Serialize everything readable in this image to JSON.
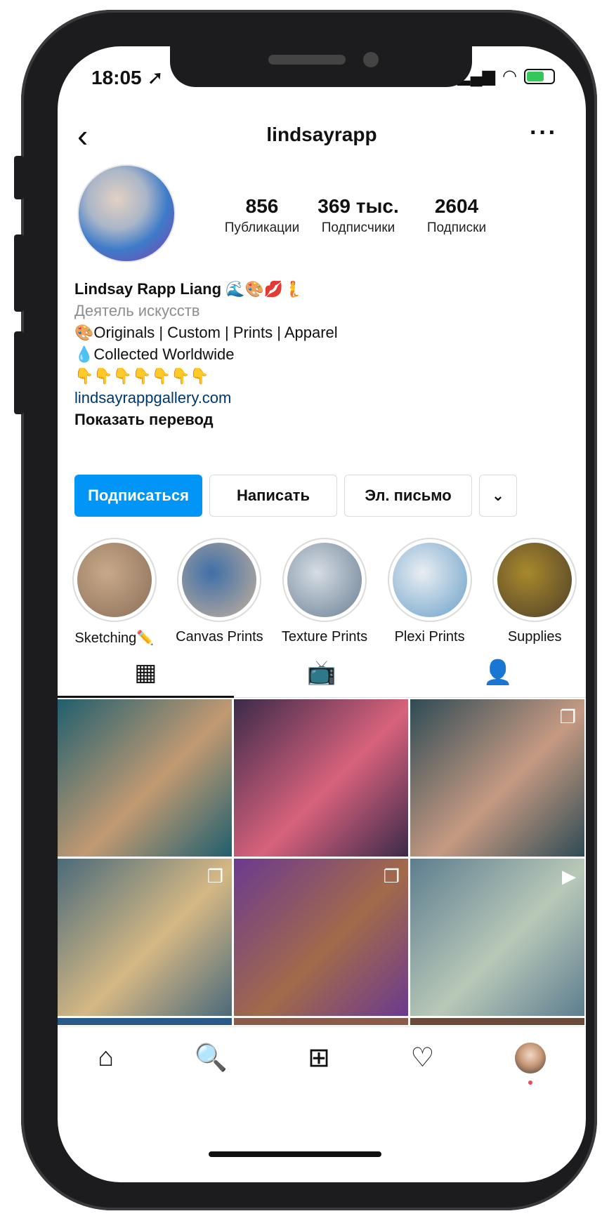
{
  "status": {
    "time": "18:05",
    "location_icon": "location-arrow-icon",
    "signal_icon": "signal-icon",
    "wifi_icon": "wifi-icon",
    "battery_icon": "battery-charging-icon"
  },
  "header": {
    "back_icon": "chevron-left-icon",
    "username": "lindsayrapp",
    "more_icon": "ellipsis-icon"
  },
  "profile": {
    "stats": [
      {
        "value": "856",
        "label": "Публикации"
      },
      {
        "value": "369 тыс.",
        "label": "Подписчики"
      },
      {
        "value": "2604",
        "label": "Подписки"
      }
    ],
    "name": "Lindsay Rapp Liang 🌊🎨💋🧜",
    "category": "Деятель искусств",
    "bio_line1": "🎨Originals | Custom | Prints | Apparel",
    "bio_line2": "💧Collected Worldwide",
    "bio_line3": "👇👇👇👇👇👇👇",
    "link": "lindsayrappgallery.com",
    "translate": "Показать перевод"
  },
  "buttons": {
    "follow": "Подписаться",
    "message": "Написать",
    "email": "Эл. письмо",
    "dropdown_icon": "chevron-down-icon"
  },
  "highlights": [
    {
      "label": "Sketching✏️",
      "color1": "#c9a98a",
      "color2": "#8a6f58"
    },
    {
      "label": "Canvas Prints",
      "color1": "#3f6fa8",
      "color2": "#c7b19c"
    },
    {
      "label": "Texture Prints",
      "color1": "#d6dde3",
      "color2": "#6a7f95"
    },
    {
      "label": "Plexi Prints",
      "color1": "#e9eef2",
      "color2": "#6aa0c9"
    },
    {
      "label": "Supplies",
      "color1": "#a9892c",
      "color2": "#4d3f2a"
    }
  ],
  "tabs": [
    {
      "icon": "grid-icon",
      "glyph": "▦"
    },
    {
      "icon": "igtv-icon",
      "glyph": "📺"
    },
    {
      "icon": "tagged-icon",
      "glyph": "👤"
    }
  ],
  "grid": [
    {
      "c1": "#1f5f6e",
      "c2": "#c29a72",
      "badge": ""
    },
    {
      "c1": "#3b2a4a",
      "c2": "#d8627c",
      "badge": ""
    },
    {
      "c1": "#2e4b55",
      "c2": "#c69a82",
      "badge": "❐"
    },
    {
      "c1": "#4a6a7a",
      "c2": "#d6b884",
      "badge": "❐"
    },
    {
      "c1": "#6b3a8f",
      "c2": "#a36a4a",
      "badge": "❐"
    },
    {
      "c1": "#5d7d8f",
      "c2": "#b9c9b8",
      "badge": "▶"
    }
  ],
  "bottom_nav": [
    {
      "name": "home-icon",
      "glyph": "⌂"
    },
    {
      "name": "search-icon",
      "glyph": "🔍"
    },
    {
      "name": "add-post-icon",
      "glyph": "⊞"
    },
    {
      "name": "heart-icon",
      "glyph": "♡"
    },
    {
      "name": "profile-avatar",
      "glyph": ""
    }
  ],
  "colors": {
    "accent": "#0095f6",
    "link": "#00376b",
    "muted": "#8e8e8e",
    "notification_dot": "#ed4956"
  }
}
